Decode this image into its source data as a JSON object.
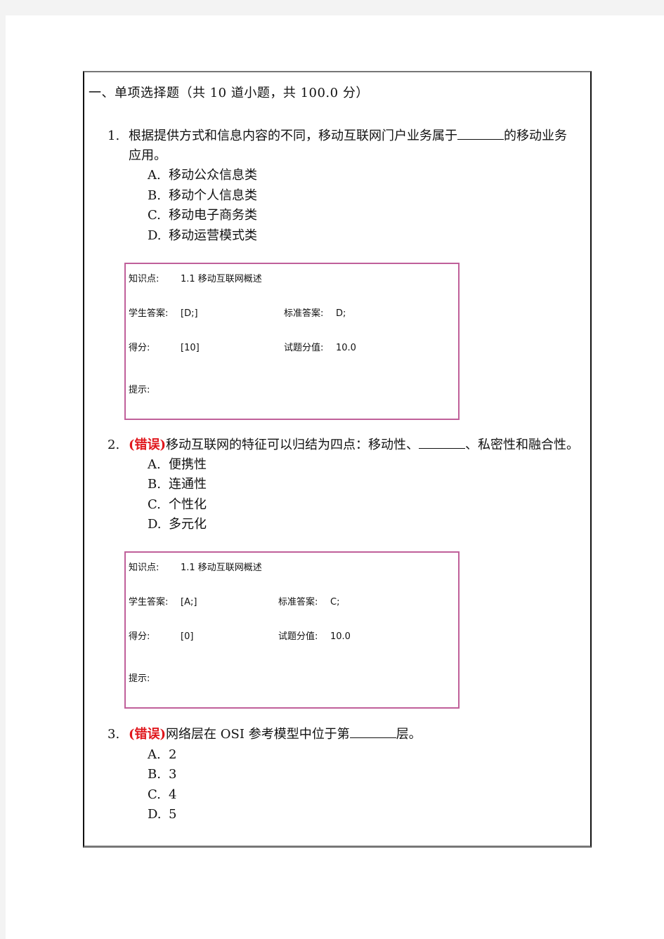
{
  "section": {
    "title": "一、单项选择题（共 10 道小题，共 100.0 分）"
  },
  "questions": [
    {
      "number": "1.",
      "status": "",
      "text_before": "根据提供方式和信息内容的不同，移动互联网门户业务属于",
      "text_after": "的移动业务",
      "text_continued": "应用。",
      "options": [
        {
          "letter": "A.",
          "text": "移动公众信息类"
        },
        {
          "letter": "B.",
          "text": "移动个人信息类"
        },
        {
          "letter": "C.",
          "text": "移动电子商务类"
        },
        {
          "letter": "D.",
          "text": "移动运营模式类"
        }
      ],
      "info": {
        "knowledge_label": "知识点:",
        "knowledge_value": "1.1  移动互联网概述",
        "student_answer_label": "学生答案:",
        "student_answer_value": "[D;]",
        "standard_answer_label": "标准答案:",
        "standard_answer_value": "D;",
        "score_label": "得分:",
        "score_value": "[10]",
        "question_value_label": "试题分值:",
        "question_value_value": "10.0",
        "hint_label": "提示:"
      }
    },
    {
      "number": "2.",
      "status": "(错误)",
      "text_before": "移动互联网的特征可以归结为四点：移动性、",
      "text_after": "、私密性和融合性。",
      "options": [
        {
          "letter": "A.",
          "text": "便携性"
        },
        {
          "letter": "B.",
          "text": "连通性"
        },
        {
          "letter": "C.",
          "text": "个性化"
        },
        {
          "letter": "D.",
          "text": "多元化"
        }
      ],
      "info": {
        "knowledge_label": "知识点:",
        "knowledge_value": "1.1  移动互联网概述",
        "student_answer_label": "学生答案:",
        "student_answer_value": "[A;]",
        "standard_answer_label": "标准答案:",
        "standard_answer_value": "C;",
        "score_label": "得分:",
        "score_value": "[0]",
        "question_value_label": "试题分值:",
        "question_value_value": "10.0",
        "hint_label": "提示:"
      }
    },
    {
      "number": "3.",
      "status": "(错误)",
      "text_before": "网络层在 OSI 参考模型中位于第",
      "text_after": "层。",
      "options": [
        {
          "letter": "A.",
          "text": "2"
        },
        {
          "letter": "B.",
          "text": "3"
        },
        {
          "letter": "C.",
          "text": "4"
        },
        {
          "letter": "D.",
          "text": "5"
        }
      ]
    }
  ],
  "colors": {
    "wrong_status": "#e0161c",
    "info_box_border": "#c0609a"
  }
}
